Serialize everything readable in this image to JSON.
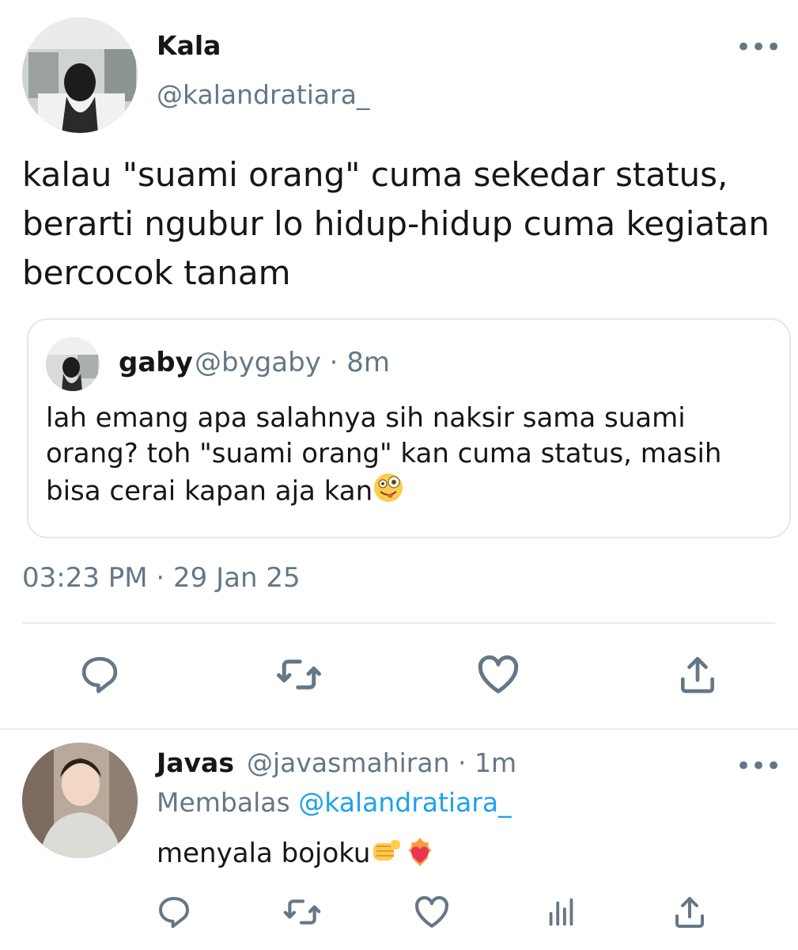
{
  "tweet": {
    "name": "Kala",
    "handle": "@kalandratiara_",
    "text": "kalau \"suami orang\" cuma sekedar status, berarti ngubur lo hidup-hidup cuma kegiatan bercocok tanam",
    "timestamp": "03:23 PM · 29 Jan 25",
    "quote": {
      "name": "gaby",
      "handle_time": "@bygaby · 8m",
      "text": "lah emang apa salahnya sih naksir sama suami orang? toh \"suami orang\" kan cuma status, masih bisa cerai kapan aja kan"
    },
    "actions": [
      "reply-icon",
      "retweet-icon",
      "like-icon",
      "share-icon"
    ]
  },
  "reply": {
    "name": "Javas",
    "handle_time": "@javasmahiran · 1m",
    "replying_prefix": "Membalas",
    "replying_to": "@kalandratiara_",
    "text": "menyala bojoku",
    "actions": [
      "reply-icon",
      "retweet-icon",
      "like-icon",
      "analytics-icon",
      "share-icon"
    ]
  },
  "colors": {
    "text": "#14171a",
    "secondary": "#657786",
    "link": "#1da1f2",
    "border": "#e1e8ed"
  }
}
